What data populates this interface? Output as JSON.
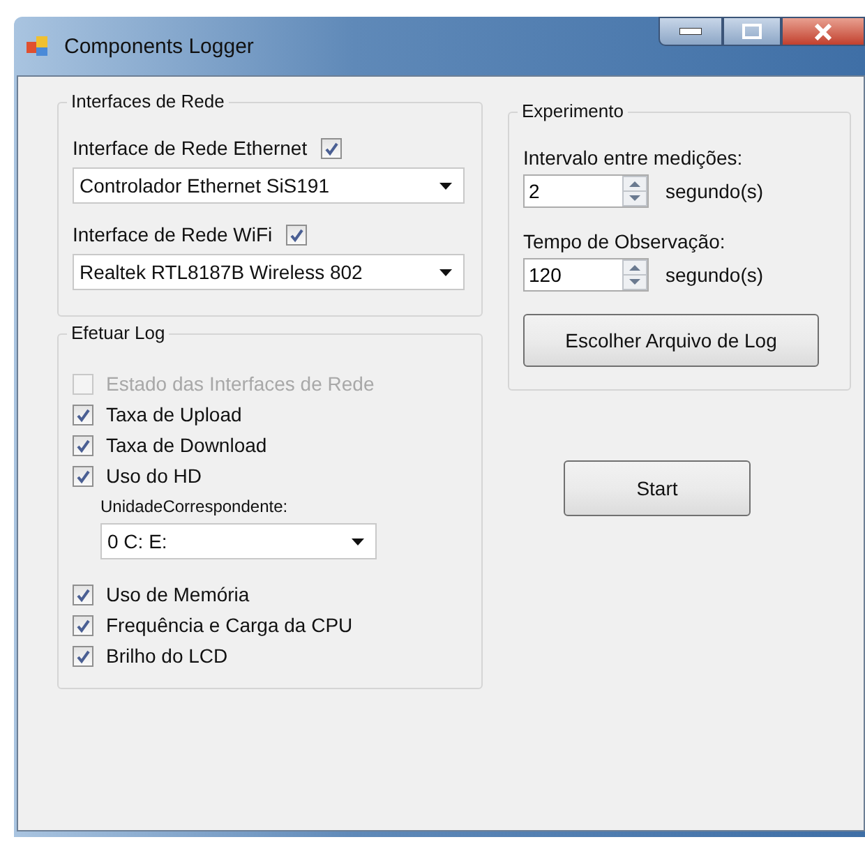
{
  "window": {
    "title": "Components Logger"
  },
  "network_group": {
    "title": "Interfaces de Rede",
    "interfaces": [
      {
        "label": "Interface de Rede Ethernet",
        "checked": true,
        "selection": "Controlador Ethernet SiS191"
      },
      {
        "label": "Interface de Rede WiFi",
        "checked": true,
        "selection": "Realtek RTL8187B Wireless 802"
      }
    ]
  },
  "log_group": {
    "title": "Efetuar Log",
    "options": [
      {
        "kind": "checkbox",
        "label": "Estado das Interfaces de Rede",
        "checked": false,
        "disabled": true
      },
      {
        "kind": "checkbox",
        "label": "Taxa de Upload",
        "checked": true,
        "disabled": false
      },
      {
        "kind": "checkbox",
        "label": "Taxa de Download",
        "checked": true,
        "disabled": false
      },
      {
        "kind": "checkbox",
        "label": "Uso do HD",
        "checked": true,
        "disabled": false
      },
      {
        "kind": "dropdown",
        "label": "UnidadeCorrespondente:",
        "selection": "0 C: E:"
      },
      {
        "kind": "checkbox",
        "label": "Uso de Memória",
        "checked": true,
        "disabled": false
      },
      {
        "kind": "checkbox",
        "label": "Frequência e Carga da CPU",
        "checked": true,
        "disabled": false
      },
      {
        "kind": "checkbox",
        "label": "Brilho do LCD",
        "checked": true,
        "disabled": false
      }
    ]
  },
  "experiment_group": {
    "title": "Experimento",
    "fields": [
      {
        "label": "Intervalo entre medições:",
        "value": "2",
        "unit": "segundo(s)"
      },
      {
        "label": "Tempo de Observação:",
        "value": "120",
        "unit": "segundo(s)"
      }
    ],
    "button": "Escolher Arquivo de Log"
  },
  "start_button": "Start"
}
